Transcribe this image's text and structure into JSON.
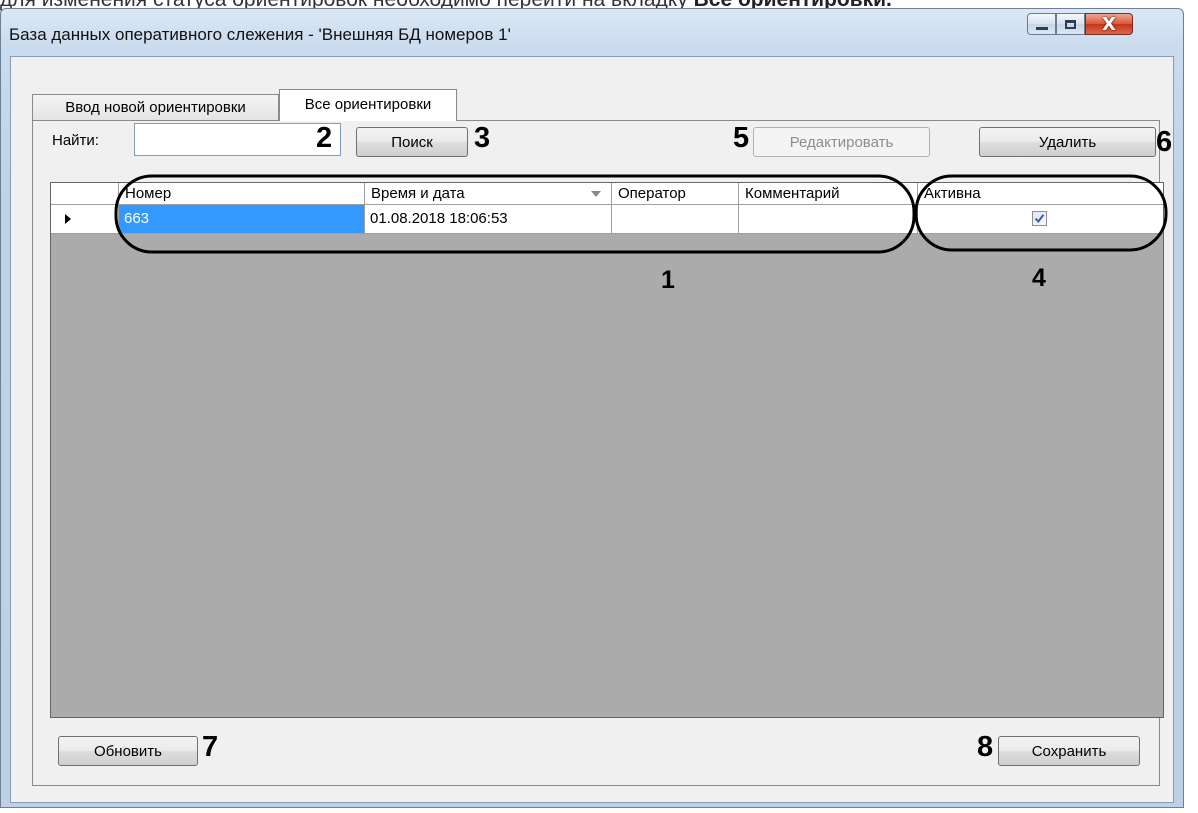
{
  "doc_caption": {
    "text": "для изменения статуса ориентировок необходимо перейти на вкладку ",
    "bold": "Все ориентировки."
  },
  "window": {
    "title": "База данных оперативного слежения - 'Внешняя БД номеров 1'",
    "controls": {
      "minimize": "minimize-icon",
      "maximize": "maximize-icon",
      "close": "close-icon"
    },
    "close_glyph": "X"
  },
  "tabs": [
    {
      "label": "Ввод новой ориентировки",
      "active": false
    },
    {
      "label": "Все ориентировки",
      "active": true
    }
  ],
  "search": {
    "label": "Найти:",
    "value": "",
    "button": "Поиск"
  },
  "toolbar": {
    "edit": "Редактировать",
    "edit_enabled": false,
    "delete": "Удалить"
  },
  "grid": {
    "columns": [
      "Номер",
      "Время и дата",
      "Оператор",
      "Комментарий",
      "Активна"
    ],
    "sort_column": "Время и дата",
    "sort_direction": "descending",
    "rows": [
      {
        "number": "663",
        "datetime": "01.08.2018 18:06:53",
        "operator": "",
        "comment": "",
        "active": true,
        "current": true
      }
    ]
  },
  "footer": {
    "refresh": "Обновить",
    "save": "Сохранить"
  },
  "markers": [
    "1",
    "2",
    "3",
    "4",
    "5",
    "6",
    "7",
    "8"
  ],
  "colors": {
    "selection": "#3399ff",
    "close_button": "#c7341a",
    "window_frame": "#bcd0e6"
  }
}
